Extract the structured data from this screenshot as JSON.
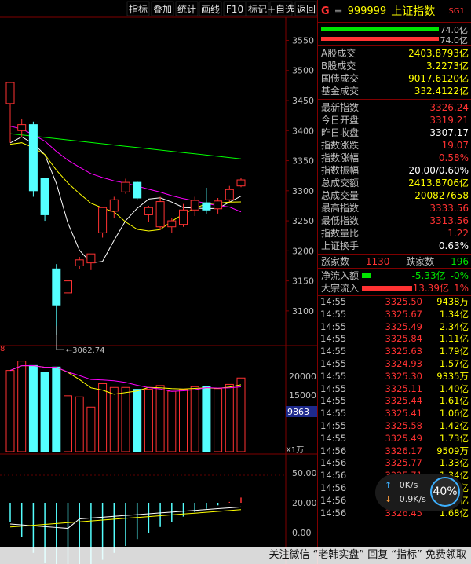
{
  "toolbar": {
    "items": [
      "指标",
      "叠加",
      "统计",
      "画线",
      "F10",
      "标记",
      "+自选",
      "返回"
    ]
  },
  "header": {
    "badge": "G",
    "menu_glyph": "≡",
    "code": "999999",
    "name": "上证指数",
    "tag": "SG1"
  },
  "flow_bars": {
    "top_value": "74.0亿",
    "bottom_value": "74.0亿"
  },
  "volume_stats": [
    {
      "label": "A股成交",
      "value": "2403.8793亿"
    },
    {
      "label": "B股成交",
      "value": "3.2273亿"
    },
    {
      "label": "国债成交",
      "value": "9017.6120亿"
    },
    {
      "label": "基金成交",
      "value": "332.4122亿"
    }
  ],
  "index_stats": [
    {
      "label": "最新指数",
      "value": "3326.24",
      "color": "red"
    },
    {
      "label": "今日开盘",
      "value": "3319.21",
      "color": "red"
    },
    {
      "label": "昨日收盘",
      "value": "3307.17",
      "color": "white"
    },
    {
      "label": "指数涨跌",
      "value": "19.07",
      "color": "red"
    },
    {
      "label": "指数涨幅",
      "value": "0.58%",
      "color": "red"
    },
    {
      "label": "指数振幅",
      "value": "20.00/0.60%",
      "color": "white"
    },
    {
      "label": "总成交额",
      "value": "2413.8706亿",
      "color": "yellow"
    },
    {
      "label": "总成交量",
      "value": "200827658",
      "color": "yellow"
    },
    {
      "label": "最高指数",
      "value": "3333.56",
      "color": "red"
    },
    {
      "label": "最低指数",
      "value": "3313.56",
      "color": "red"
    },
    {
      "label": "指数量比",
      "value": "1.22",
      "color": "red"
    },
    {
      "label": "上证换手",
      "value": "0.63%",
      "color": "white"
    }
  ],
  "breadth": {
    "up_label": "涨家数",
    "up_value": "1130",
    "down_label": "跌家数",
    "down_value": "196"
  },
  "flows": [
    {
      "label": "净流入额",
      "value": "-5.33亿",
      "pct": "-0%",
      "color": "#00e600"
    },
    {
      "label": "大宗流入",
      "value": "13.39亿",
      "pct": "1%",
      "color": "#ff3232"
    }
  ],
  "ticks": [
    {
      "time": "14:55",
      "price": "3325.50",
      "vol": "9438万"
    },
    {
      "time": "14:55",
      "price": "3325.67",
      "vol": "1.34亿"
    },
    {
      "time": "14:55",
      "price": "3325.49",
      "vol": "2.34亿"
    },
    {
      "time": "14:55",
      "price": "3325.84",
      "vol": "1.11亿"
    },
    {
      "time": "14:55",
      "price": "3325.63",
      "vol": "1.79亿"
    },
    {
      "time": "14:55",
      "price": "3324.93",
      "vol": "1.57亿"
    },
    {
      "time": "14:55",
      "price": "3325.30",
      "vol": "9335万"
    },
    {
      "time": "14:55",
      "price": "3325.11",
      "vol": "1.40亿"
    },
    {
      "time": "14:55",
      "price": "3325.44",
      "vol": "1.61亿"
    },
    {
      "time": "14:55",
      "price": "3325.41",
      "vol": "1.06亿"
    },
    {
      "time": "14:55",
      "price": "3325.58",
      "vol": "1.42亿"
    },
    {
      "time": "14:55",
      "price": "3325.49",
      "vol": "1.73亿"
    },
    {
      "time": "14:56",
      "price": "3326.17",
      "vol": "9509万"
    },
    {
      "time": "14:56",
      "price": "3325.77",
      "vol": "1.33亿"
    },
    {
      "time": "14:56",
      "price": "3325.71",
      "vol": "1.34亿"
    },
    {
      "time": "14:56",
      "price": "3325.48",
      "vol": "1.53亿"
    },
    {
      "time": "14:56",
      "price": "3325.89",
      "vol": "1.50亿"
    },
    {
      "time": "14:56",
      "price": "3326.45",
      "vol": "1.68亿"
    }
  ],
  "speed_widget": {
    "up": "0K/s",
    "down": "0.9K/s",
    "percent": "40%",
    "up_arrow": "↑",
    "down_arrow": "↓"
  },
  "watermark": "关注微信 “老韩实盘” 回复 “指标” 免费领取",
  "colors": {
    "up": "#ff3232",
    "down": "#54ffff",
    "ma5": "#ffffff",
    "ma10": "#ffff00",
    "ma20": "#ff00ff",
    "ma60": "#00ff00",
    "grid": "#800000"
  },
  "chart_data": {
    "type": "candlestick",
    "price_axis": {
      "ticks": [
        "3550",
        "3500",
        "3450",
        "3400",
        "3350",
        "3300",
        "3250",
        "3200",
        "3150",
        "3100"
      ],
      "range": [
        3075,
        3565
      ]
    },
    "low_marker": "3062.74",
    "candles": [
      {
        "o": 3445,
        "h": 3480,
        "l": 3380,
        "c": 3480
      },
      {
        "o": 3400,
        "h": 3420,
        "l": 3390,
        "c": 3410
      },
      {
        "o": 3410,
        "h": 3415,
        "l": 3290,
        "c": 3300
      },
      {
        "o": 3320,
        "h": 3320,
        "l": 3250,
        "c": 3260
      },
      {
        "o": 3170,
        "h": 3178,
        "l": 3060,
        "c": 3110
      },
      {
        "o": 3130,
        "h": 3150,
        "l": 3110,
        "c": 3150
      },
      {
        "o": 3175,
        "h": 3190,
        "l": 3170,
        "c": 3185
      },
      {
        "o": 3180,
        "h": 3195,
        "l": 3168,
        "c": 3195
      },
      {
        "o": 3230,
        "h": 3272,
        "l": 3222,
        "c": 3272
      },
      {
        "o": 3266,
        "h": 3290,
        "l": 3255,
        "c": 3285
      },
      {
        "o": 3298,
        "h": 3320,
        "l": 3295,
        "c": 3314
      },
      {
        "o": 3314,
        "h": 3316,
        "l": 3284,
        "c": 3288
      },
      {
        "o": 3260,
        "h": 3275,
        "l": 3248,
        "c": 3272
      },
      {
        "o": 3240,
        "h": 3290,
        "l": 3235,
        "c": 3282
      },
      {
        "o": 3240,
        "h": 3255,
        "l": 3230,
        "c": 3250
      },
      {
        "o": 3244,
        "h": 3278,
        "l": 3240,
        "c": 3268
      },
      {
        "o": 3268,
        "h": 3290,
        "l": 3258,
        "c": 3284
      },
      {
        "o": 3280,
        "h": 3305,
        "l": 3262,
        "c": 3268
      },
      {
        "o": 3270,
        "h": 3288,
        "l": 3262,
        "c": 3283
      },
      {
        "o": 3285,
        "h": 3308,
        "l": 3282,
        "c": 3302
      },
      {
        "o": 3308,
        "h": 3322,
        "l": 3306,
        "c": 3318
      }
    ],
    "volume_axis": {
      "ticks": [
        "20000",
        "15000"
      ],
      "current": "9863",
      "unit": "X1万"
    },
    "volumes": [
      21500,
      24000,
      22800,
      21000,
      22400,
      14800,
      14500,
      11800,
      18000,
      17000,
      17000,
      16500,
      16500,
      17500,
      16000,
      16500,
      17200,
      17300,
      16700,
      17800,
      19500
    ],
    "macd_axis": {
      "ticks": [
        "50.00",
        "20.00",
        "0.00"
      ]
    },
    "macd_hist": [
      -22,
      -40,
      -58,
      -70,
      -80,
      -82,
      -80,
      -74,
      -66,
      -58,
      -50,
      -42,
      -35,
      -28,
      -22,
      -16,
      -11,
      -7,
      -3,
      1,
      6
    ]
  }
}
